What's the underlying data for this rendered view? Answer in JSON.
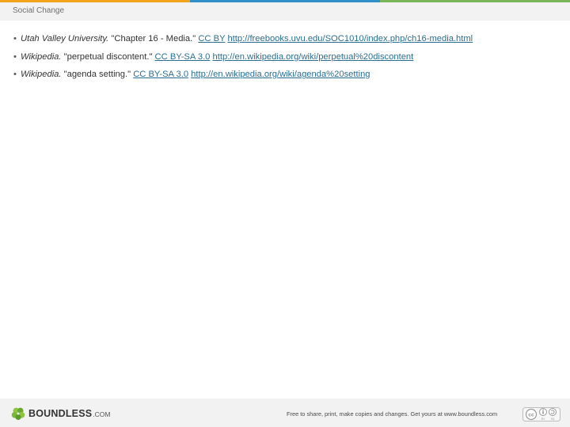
{
  "colors": {
    "top_bar": [
      "#f3a21c",
      "#2e8fc9",
      "#7ab55c"
    ],
    "header_background": "#f2f2f2",
    "link": "#2a6f92",
    "logo_leaf": "#8cc63f"
  },
  "header": {
    "title": "Social Change"
  },
  "references": [
    {
      "bullet": "•",
      "source": "Utah Valley University.",
      "title": "\"Chapter 16 - Media.\"",
      "license": "CC BY",
      "url": "http://freebooks.uvu.edu/SOC1010/index.php/ch16-media.html"
    },
    {
      "bullet": "•",
      "source": "Wikipedia.",
      "title": "\"perpetual discontent.\"",
      "license": "CC BY-SA 3.0",
      "url": "http://en.wikipedia.org/wiki/perpetual%20discontent"
    },
    {
      "bullet": "•",
      "source": "Wikipedia.",
      "title": "\"agenda setting.\"",
      "license": "CC BY-SA 3.0",
      "url": "http://en.wikipedia.org/wiki/agenda%20setting"
    }
  ],
  "footer": {
    "logo_text": "BOUNDLESS",
    "logo_suffix": ".COM",
    "logo_icon": "boundless-leaf-icon",
    "note": "Free to share, print, make copies and changes. Get yours at www.boundless.com",
    "license_icon": "creative-commons-icon"
  }
}
